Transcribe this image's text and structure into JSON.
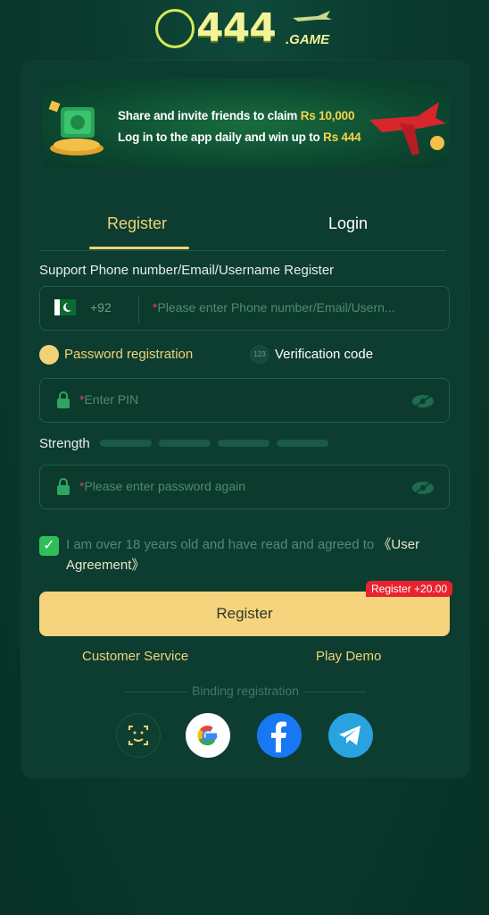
{
  "logo": {
    "main": "444",
    "sub": ".GAME"
  },
  "banner": {
    "line1_prefix": "Share and invite friends to claim ",
    "line1_amount": "Rs 10,000",
    "line2_prefix": "Log in to the app daily and win up to ",
    "line2_amount": "Rs 444"
  },
  "tabs": {
    "register": "Register",
    "login": "Login"
  },
  "form": {
    "account_label": "Support Phone number/Email/Username Register",
    "country_code": "+92",
    "account_placeholder": "Please enter Phone number/Email/Usern...",
    "method_password": "Password registration",
    "method_code": "Verification code",
    "pin_placeholder": "Enter PIN",
    "strength_label": "Strength",
    "confirm_placeholder": "Please enter password again",
    "agree_text": "I am over 18 years old and have read and agreed to ",
    "agree_link": "《User Agreement》",
    "register_button": "Register",
    "register_bonus": "Register +20.00"
  },
  "links": {
    "customer_service": "Customer Service",
    "play_demo": "Play Demo"
  },
  "binding": {
    "label": "Binding registration"
  },
  "colors": {
    "accent": "#f6d37d",
    "background": "#0a3b2e",
    "bonus": "#e8232f",
    "check": "#2fbf5a"
  },
  "social": [
    "face-id-icon",
    "google-icon",
    "facebook-icon",
    "telegram-icon"
  ]
}
